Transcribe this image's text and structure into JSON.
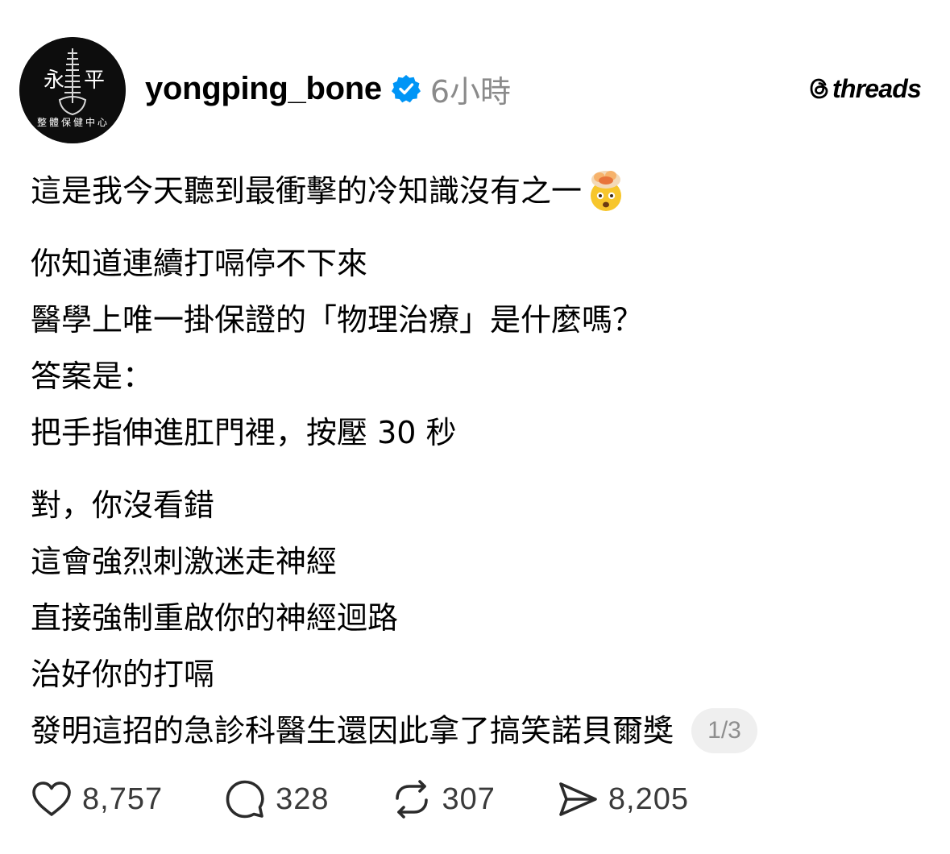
{
  "header": {
    "avatar_text": {
      "left_char": "永",
      "right_char": "平",
      "arc_text": "整體保健中心"
    },
    "username": "yongping_bone",
    "timestamp": "6小時",
    "brand": "threads",
    "verified_color": "#0095f6"
  },
  "post": {
    "paragraphs": [
      [
        "這是我今天聽到最衝擊的冷知識沒有之一"
      ],
      [
        "你知道連續打嗝停不下來",
        "醫學上唯一掛保證的「物理治療」是什麼嗎？",
        "答案是：",
        "把手指伸進肛門裡，按壓 30 秒"
      ],
      [
        "對，你沒看錯",
        "這會強烈刺激迷走神經",
        "直接強制重啟你的神經迴路",
        "治好你的打嗝",
        "發明這招的急診科醫生還因此拿了搞笑諾貝爾獎"
      ]
    ],
    "emoji": "exploding-head",
    "page_indicator": "1/3"
  },
  "actions": {
    "likes": "8,757",
    "replies": "328",
    "reposts": "307",
    "shares": "8,205"
  }
}
